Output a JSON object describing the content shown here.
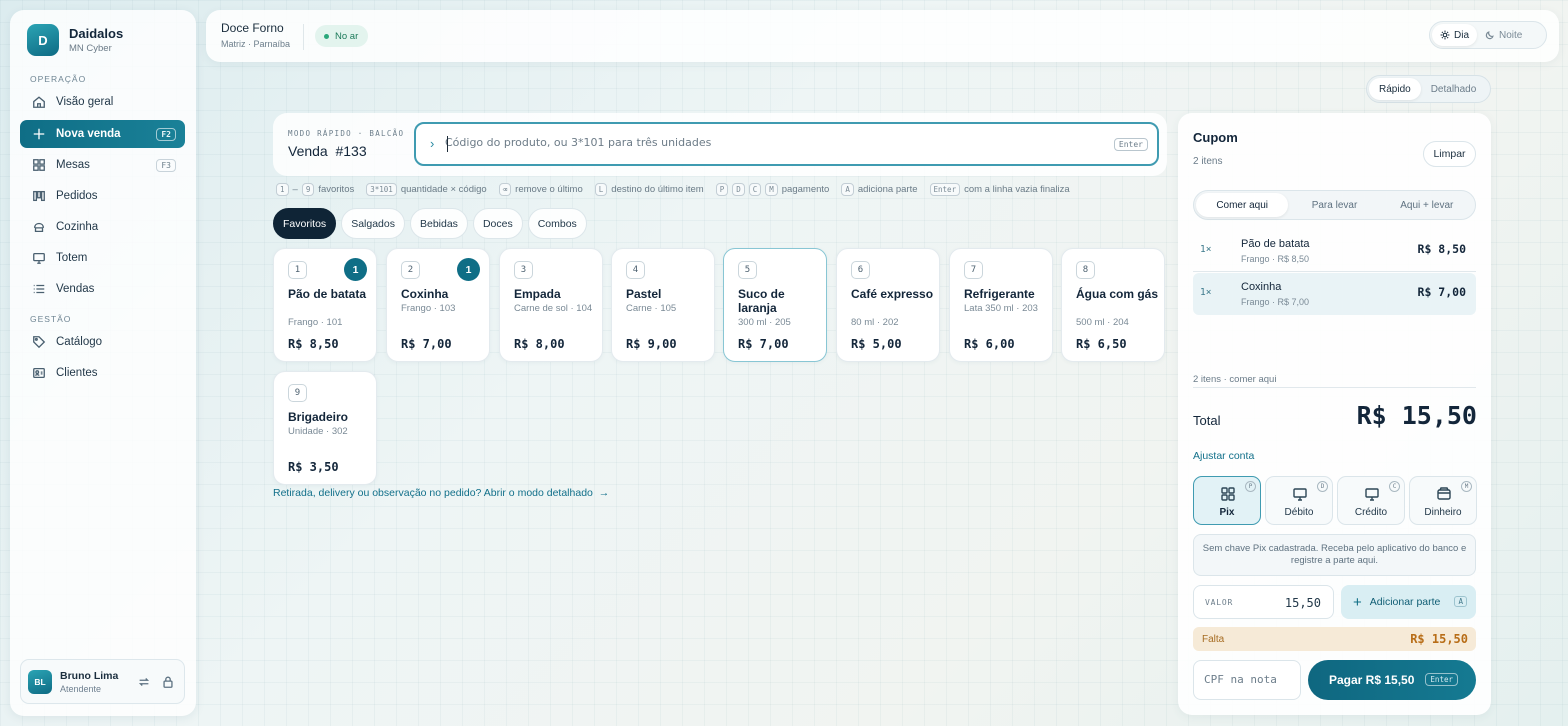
{
  "sidebar": {
    "brand": {
      "initial": "D",
      "name": "Daidalos",
      "sub": "MN Cyber"
    },
    "section_operacao": "OPERAÇÃO",
    "section_gestao": "GESTÃO",
    "items": [
      {
        "label": "Visão geral",
        "icon": "home-icon"
      },
      {
        "label": "Nova venda",
        "icon": "plus-icon",
        "key": "F2",
        "active": true
      },
      {
        "label": "Mesas",
        "icon": "grid-icon",
        "key": "F3"
      },
      {
        "label": "Pedidos",
        "icon": "columns-icon"
      },
      {
        "label": "Cozinha",
        "icon": "kitchen-icon"
      },
      {
        "label": "Totem",
        "icon": "monitor-icon"
      },
      {
        "label": "Vendas",
        "icon": "list-icon"
      },
      {
        "label": "Catálogo",
        "icon": "tag-icon"
      },
      {
        "label": "Clientes",
        "icon": "id-card-icon"
      }
    ],
    "user": {
      "initials": "BL",
      "name": "Bruno Lima",
      "role": "Atendente"
    }
  },
  "topbar": {
    "store_name": "Doce Forno",
    "store_loc": "Matriz · Parnaíba",
    "status": "No ar",
    "theme_day": "Dia",
    "theme_night": "Noite"
  },
  "mode": {
    "rapido": "Rápido",
    "detalhado": "Detalhado"
  },
  "quick": {
    "label": "MODO RÁPIDO · BALCÃO",
    "title": "Venda  #133",
    "placeholder": "Código do produto, ou 3*101 para três unidades",
    "enter_key": "Enter"
  },
  "hints": {
    "k1": "1",
    "dash": "–",
    "k9": "9",
    "favoritos": "favoritos",
    "k_mult": "3*101",
    "quantidade": "quantidade × código",
    "k_back": "⌫",
    "remove": "remove o último",
    "k_l": "L",
    "destino": "destino do último item",
    "kp": "P",
    "kd": "D",
    "kc": "C",
    "km": "M",
    "pagamento": "pagamento",
    "ka": "A",
    "adiciona": "adiciona parte",
    "k_enter": "Enter",
    "finaliza": "com a linha vazia finaliza"
  },
  "categories": [
    "Favoritos",
    "Salgados",
    "Bebidas",
    "Doces",
    "Combos"
  ],
  "products": [
    {
      "n": "1",
      "name": "Pão de batata",
      "sub": "Frango · 101",
      "price": "R$ 8,50",
      "qty": "1"
    },
    {
      "n": "2",
      "name": "Coxinha",
      "sub": "Frango · 103",
      "price": "R$ 7,00",
      "qty": "1"
    },
    {
      "n": "3",
      "name": "Empada",
      "sub": "Carne de sol · 104",
      "price": "R$ 8,00"
    },
    {
      "n": "4",
      "name": "Pastel",
      "sub": "Carne · 105",
      "price": "R$ 9,00"
    },
    {
      "n": "5",
      "name": "Suco de laranja",
      "sub": "300 ml · 205",
      "price": "R$ 7,00"
    },
    {
      "n": "6",
      "name": "Café expresso",
      "sub": "80 ml · 202",
      "price": "R$ 5,00"
    },
    {
      "n": "7",
      "name": "Refrigerante",
      "sub": "Lata 350 ml · 203",
      "price": "R$ 6,00"
    },
    {
      "n": "8",
      "name": "Água com gás",
      "sub": "500 ml · 204",
      "price": "R$ 6,50"
    },
    {
      "n": "9",
      "name": "Brigadeiro",
      "sub": "Unidade · 302",
      "price": "R$ 3,50"
    }
  ],
  "detail_link": "Retirada, delivery ou observação no pedido? Abrir o modo detalhado  →",
  "cupom": {
    "title": "Cupom",
    "count": "2 itens",
    "clear": "Limpar",
    "tabs": [
      "Comer aqui",
      "Para levar",
      "Aqui + levar"
    ],
    "items": [
      {
        "qty": "1×",
        "name": "Pão de batata",
        "detail": "Frango · R$ 8,50",
        "value": "R$ 8,50"
      },
      {
        "qty": "1×",
        "name": "Coxinha",
        "detail": "Frango · R$ 7,00",
        "value": "R$ 7,00"
      }
    ],
    "summary": "2 itens · comer aqui",
    "total_label": "Total",
    "total_value": "R$ 15,50",
    "adjust": "Ajustar conta",
    "payments": [
      {
        "label": "Pix",
        "key": "P",
        "icon": "pix-grid-icon"
      },
      {
        "label": "Débito",
        "key": "D",
        "icon": "card-terminal-icon"
      },
      {
        "label": "Crédito",
        "key": "C",
        "icon": "card-terminal-icon"
      },
      {
        "label": "Dinheiro",
        "key": "M",
        "icon": "wallet-icon"
      }
    ],
    "pix_info": "Sem chave Pix cadastrada. Receba pelo aplicativo do banco e registre a parte aqui.",
    "valor_label": "VALOR",
    "valor_value": "15,50",
    "add_part": "Adicionar parte",
    "add_key": "A",
    "falta_label": "Falta",
    "falta_value": "R$ 15,50",
    "cpf_placeholder": "CPF na nota",
    "pay_label": "Pagar R$ 15,50",
    "pay_key": "Enter"
  }
}
